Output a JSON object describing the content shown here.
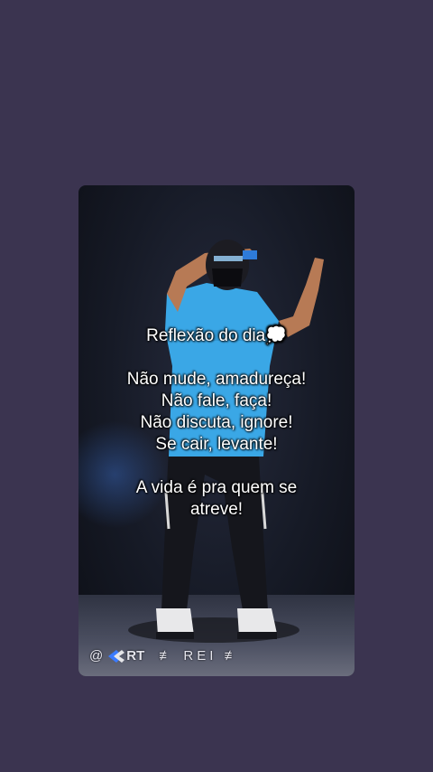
{
  "caption": {
    "title": "Reflexão do dia💭",
    "lines": [
      "Não mude, amadureça!",
      "Não fale, faça!",
      "Não discuta, ignore!",
      "Se cair, levante!"
    ],
    "closing": [
      "A vida é pra quem se",
      "atreve!"
    ]
  },
  "watermark": {
    "at": "@",
    "rt": "RT",
    "name": "≢ REI ≢"
  },
  "colors": {
    "background": "#3b3450",
    "shirt": "#3aa7e6",
    "pants": "#15161c"
  }
}
